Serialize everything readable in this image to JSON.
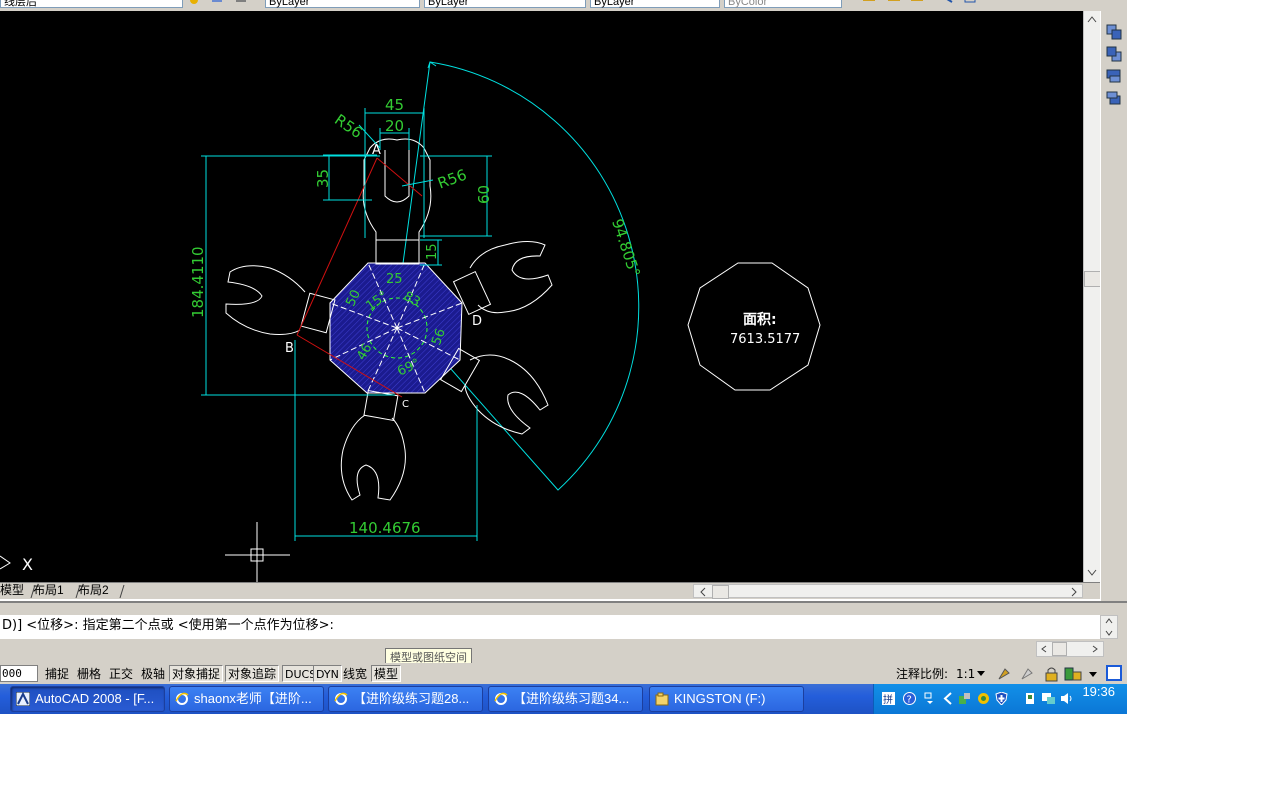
{
  "toolbar": {
    "layer_value": "线层后",
    "linetype1": "ByLayer",
    "linetype2": "ByLayer",
    "lineweight": "ByLayer",
    "plotstyle": "ByColor"
  },
  "drawing": {
    "dims": {
      "d45": "45",
      "d20": "20",
      "r56a": "R56",
      "r56b": "R56",
      "d35": "35",
      "d60": "60",
      "d15": "15",
      "d25": "25",
      "d50": "50",
      "a15": "15°",
      "a83": "83",
      "d56": "56",
      "d46": "46",
      "a69": "69°",
      "height": "184.4110",
      "width": "140.4676",
      "angle": "94.805°"
    },
    "points": {
      "A": "A",
      "B": "B",
      "C": "C",
      "D": "D"
    },
    "area_label": "面积:",
    "area_value": "7613.5177",
    "ucs_x": "X"
  },
  "tabs": {
    "model": "模型",
    "layout1": "布局1",
    "layout2": "布局2"
  },
  "command": {
    "line": "D)] <位移>:  指定第二个点或 <使用第一个点作为位移>:",
    "tooltip": "模型或图纸空间"
  },
  "status": {
    "coord": "000",
    "snap": "捕捉",
    "grid": "栅格",
    "ortho": "正交",
    "polar": "极轴",
    "osnap": "对象捕捉",
    "otrack": "对象追踪",
    "ducs": "DUCS",
    "dyn": "DYN",
    "lwt": "线宽",
    "model": "模型",
    "anno_scale_label": "注释比例:",
    "anno_scale_value": "1:1"
  },
  "taskbar": {
    "items": [
      {
        "label": "AutoCAD 2008 - [F..."
      },
      {
        "label": "shaonx老师【进阶..."
      },
      {
        "label": "【进阶级练习题28..."
      },
      {
        "label": "【进阶级练习题34..."
      },
      {
        "label": "KINGSTON (F:)"
      }
    ],
    "clock": "19:36"
  },
  "colors": {
    "dimension": "#00e0e0",
    "text_green": "#33cc33",
    "construction_red": "#d01010",
    "hatch_blue": "#1a1a99",
    "geometry": "#ffffff"
  }
}
